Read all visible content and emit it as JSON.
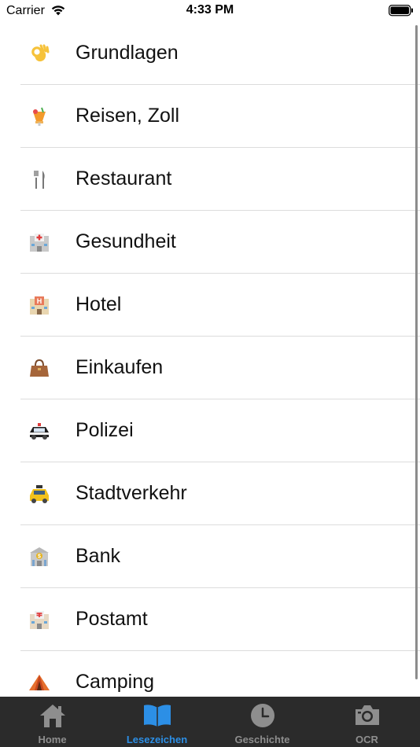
{
  "status_bar": {
    "carrier": "Carrier",
    "time": "4:33 PM"
  },
  "list": {
    "items": [
      {
        "label": "Grundlagen",
        "icon": "ok-hand-icon"
      },
      {
        "label": "Reisen, Zoll",
        "icon": "tropical-drink-icon"
      },
      {
        "label": "Restaurant",
        "icon": "fork-knife-icon"
      },
      {
        "label": "Gesundheit",
        "icon": "hospital-icon"
      },
      {
        "label": "Hotel",
        "icon": "hotel-icon"
      },
      {
        "label": "Einkaufen",
        "icon": "handbag-icon"
      },
      {
        "label": "Polizei",
        "icon": "police-car-icon"
      },
      {
        "label": "Stadtverkehr",
        "icon": "taxi-icon"
      },
      {
        "label": "Bank",
        "icon": "bank-icon"
      },
      {
        "label": "Postamt",
        "icon": "post-office-icon"
      },
      {
        "label": "Camping",
        "icon": "tent-icon"
      }
    ]
  },
  "tabbar": {
    "active_color": "#2c8fe6",
    "inactive_color": "#8e8e8e",
    "tabs": [
      {
        "label": "Home",
        "icon": "home-icon",
        "active": false
      },
      {
        "label": "Lesezeichen",
        "icon": "book-icon",
        "active": true
      },
      {
        "label": "Geschichte",
        "icon": "clock-icon",
        "active": false
      },
      {
        "label": "OCR",
        "icon": "camera-icon",
        "active": false
      }
    ]
  }
}
